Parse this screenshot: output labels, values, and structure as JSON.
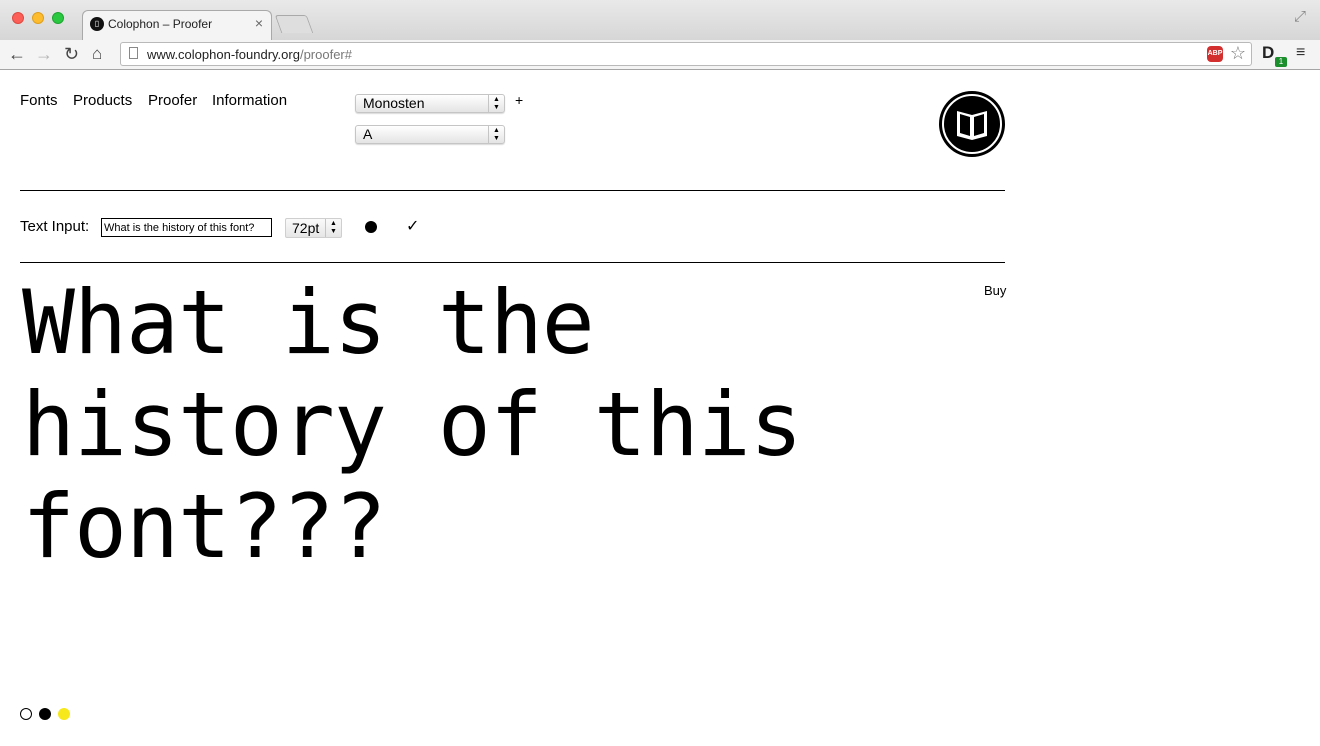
{
  "browser": {
    "tab_title": "Colophon – Proofer",
    "url_host": "www.colophon-foundry.org",
    "url_path": "/proofer#",
    "extension_badge": "1",
    "abp_label": "ABP"
  },
  "nav": {
    "items": [
      {
        "label": "Fonts"
      },
      {
        "label": "Products"
      },
      {
        "label": "Proofer"
      },
      {
        "label": "Information"
      }
    ]
  },
  "font_picker": {
    "family": "Monosten",
    "style": "A",
    "add_label": "+"
  },
  "controls": {
    "text_input_label": "Text Input:",
    "text_input_value": "What is the history of this font?",
    "size_value": "72pt",
    "bullet_glyph": "●",
    "check_glyph": "✓"
  },
  "proof": {
    "text": "What is the history of this font???",
    "buy_label": "Buy"
  },
  "colors": {
    "swatches": [
      "#ffffff",
      "#000000",
      "#f6e81a"
    ]
  }
}
